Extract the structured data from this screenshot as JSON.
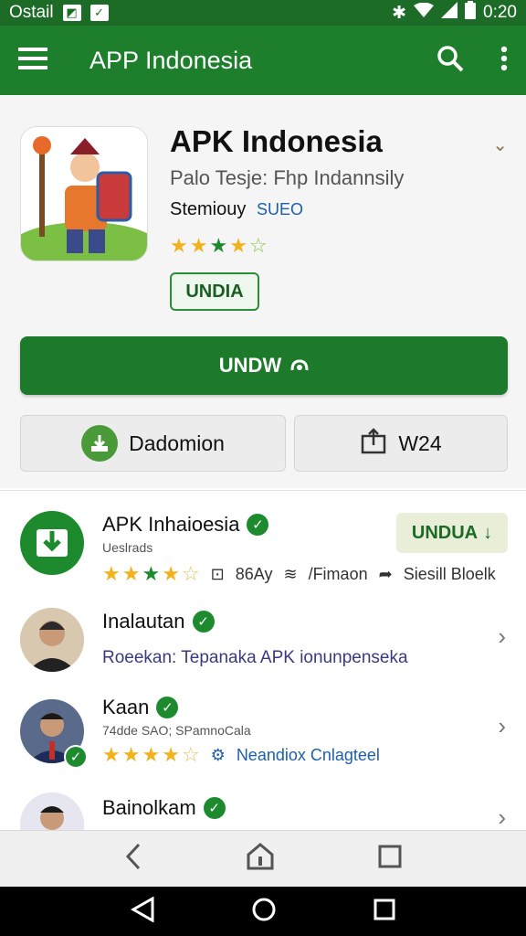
{
  "status_bar": {
    "carrier": "Ostail",
    "time": "0:20",
    "icons": [
      "image-icon",
      "mail-icon",
      "bluetooth-icon",
      "wifi-icon",
      "signal-icon",
      "battery-icon"
    ]
  },
  "app_bar": {
    "title": "APP Indonesia",
    "icons": [
      "menu-icon",
      "search-icon",
      "more-vert-icon"
    ]
  },
  "app": {
    "name": "APK Indonesia",
    "subtitle": "Palo Tesje: Fhp Indannsily",
    "developer": "Stemiouy",
    "tag": "SUEO",
    "rating": 4,
    "chip_label": "UNDIA",
    "main_button_label": "UNDW",
    "secondary_left_label": "Dadomion",
    "secondary_right_label": "W24"
  },
  "list": [
    {
      "title": "APK Inhaioesia",
      "sub": "Ueslrads",
      "rating": 4,
      "meta1": "86Ay",
      "meta2": "/Fimaon",
      "meta3": "Siesill Bloelk",
      "action_label": "UNDUA"
    },
    {
      "title": "Inalautan",
      "desc": "Roeekan: Tepanaka APK ionunpenseka"
    },
    {
      "title": "Kaan",
      "sub": "74dde SAO; SPamnoCala",
      "rating": 4,
      "meta": "Neandiox Cnlagteel"
    },
    {
      "title": "Bainolkam"
    }
  ],
  "colors": {
    "primary": "#1d7f2c",
    "status": "#1c6b26",
    "star": "#f2b21b"
  }
}
